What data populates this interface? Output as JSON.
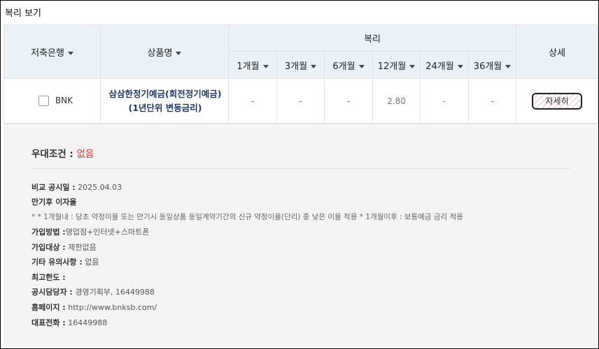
{
  "title": "복리 보기",
  "header": {
    "bank": "저축은행",
    "product": "상품명",
    "compound": "복리",
    "detail": "상세",
    "periods": [
      "1개월",
      "3개월",
      "6개월",
      "12개월",
      "24개월",
      "36개월"
    ]
  },
  "row": {
    "bank": "BNK",
    "product": "삼삼한정기예금(회전정기예금) (1년단위 변동금리)",
    "rates": [
      "-",
      "-",
      "-",
      "2.80",
      "-",
      "-"
    ],
    "detail_button": "자세히"
  },
  "details": {
    "pref_label": "우대조건 :",
    "pref_value": "없음",
    "compare_label": "비교 공시일 :",
    "compare_value": "2025.04.03",
    "after_maturity_label": "만기후 이자율",
    "after_maturity_note": "* * 1개월내 : 당초 약정이율 또는 만기시 동일상품 동일계약기간의 신규 약정이율(단리) 중 낮은 이율 적용 * 1개월이후 : 보통예금 금리 적용",
    "join_method_label": "가입방법 :",
    "join_method_value": "영업점+인터넷+스마트폰",
    "join_target_label": "가입대상 :",
    "join_target_value": "제한없음",
    "other_label": "기타 유의사항 :",
    "other_value": "없음",
    "limit_label": "최고한도 :",
    "limit_value": "",
    "contact_label": "공시담당자 :",
    "contact_value": "경영기획부, 16449988",
    "homepage_label": "홈페이지 :",
    "homepage_value": "http://www.bnksb.com/",
    "phone_label": "대표전화 :",
    "phone_value": "16449988"
  }
}
